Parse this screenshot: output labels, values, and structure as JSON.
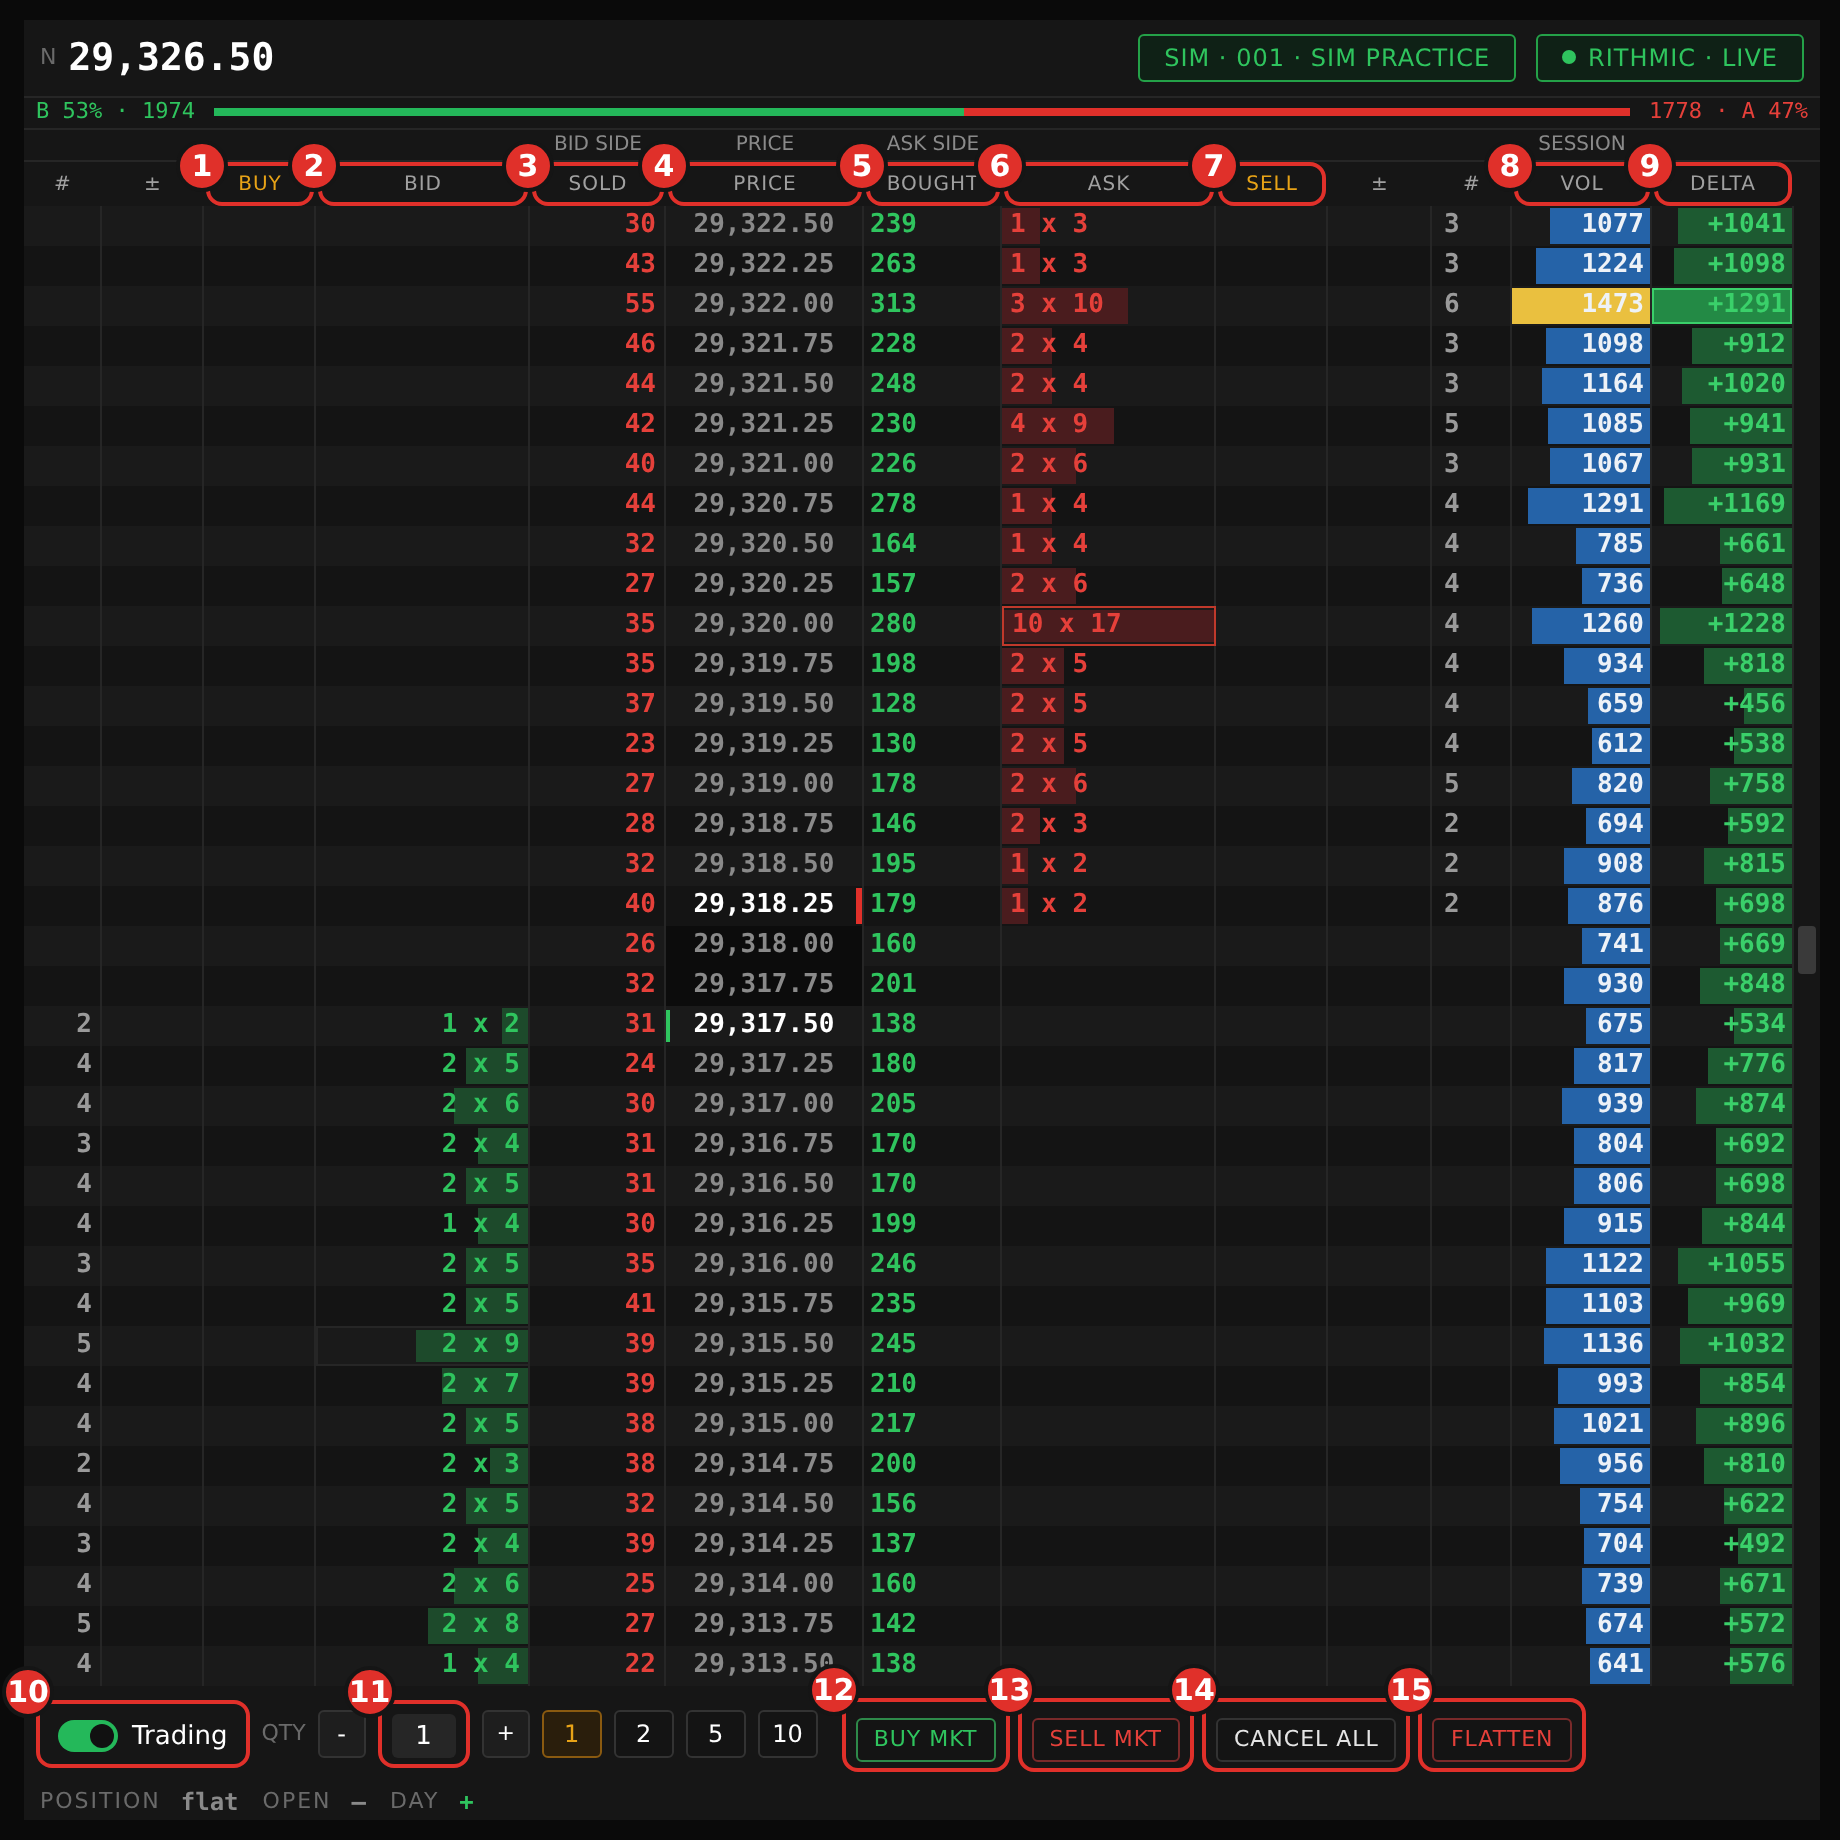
{
  "ticker": {
    "label": "N",
    "price": "29,326.50"
  },
  "accounts": [
    {
      "text": "SIM · 001 · SIM PRACTICE",
      "dot": false
    },
    {
      "text": "RITHMIC · LIVE",
      "dot": true
    }
  ],
  "balance": {
    "bid_text": "B 53% · 1974",
    "ask_text": "1778 · A 47%",
    "level": 0.53
  },
  "columns": [
    {
      "label": "#",
      "highlighted": false
    },
    {
      "label": "±",
      "highlighted": false
    },
    {
      "label": "BUY",
      "highlighted": true,
      "callout": "1"
    },
    {
      "label": "BID",
      "highlighted": false,
      "callout": "2"
    },
    {
      "label": "SOLD",
      "highlighted": false,
      "callout": "3",
      "group": "BID SIDE"
    },
    {
      "label": "PRICE",
      "highlighted": false,
      "callout": "4",
      "group": "PRICE"
    },
    {
      "label": "BOUGHT",
      "highlighted": false,
      "callout": "5",
      "group": "ASK SIDE"
    },
    {
      "label": "ASK",
      "highlighted": false,
      "callout": "6"
    },
    {
      "label": "SELL",
      "highlighted": true,
      "callout": "7"
    },
    {
      "label": "±",
      "highlighted": false
    },
    {
      "label": "#",
      "highlighted": false
    },
    {
      "label": "VOL",
      "highlighted": false,
      "callout": "8",
      "group": "SESSION"
    },
    {
      "label": "DELTA",
      "highlighted": false,
      "callout": "9"
    }
  ],
  "rows": [
    {
      "sold": "30",
      "price": "29,322.50",
      "kind": "normal",
      "bought": "239",
      "ask": {
        "text": "1 x 3",
        "level": 0.18,
        "outlined": false
      },
      "ask_orders": "3",
      "vol": {
        "text": "1077",
        "level": 0.73,
        "highlighted": false
      },
      "delta": {
        "text": "+1041",
        "level": 0.81,
        "highlighted": false
      }
    },
    {
      "sold": "43",
      "price": "29,322.25",
      "kind": "normal",
      "bought": "263",
      "ask": {
        "text": "1 x 3",
        "level": 0.18,
        "outlined": false
      },
      "ask_orders": "3",
      "vol": {
        "text": "1224",
        "level": 0.83,
        "highlighted": false
      },
      "delta": {
        "text": "+1098",
        "level": 0.85,
        "highlighted": false
      }
    },
    {
      "sold": "55",
      "price": "29,322.00",
      "kind": "normal",
      "bought": "313",
      "ask": {
        "text": "3 x 10",
        "level": 0.59,
        "outlined": false
      },
      "ask_orders": "6",
      "vol": {
        "text": "1473",
        "level": 1,
        "highlighted": true
      },
      "delta": {
        "text": "+1291",
        "level": 1,
        "highlighted": true
      }
    },
    {
      "sold": "46",
      "price": "29,321.75",
      "kind": "normal",
      "bought": "228",
      "ask": {
        "text": "2 x 4",
        "level": 0.24,
        "outlined": false
      },
      "ask_orders": "3",
      "vol": {
        "text": "1098",
        "level": 0.75,
        "highlighted": false
      },
      "delta": {
        "text": "+912",
        "level": 0.71,
        "highlighted": false
      }
    },
    {
      "sold": "44",
      "price": "29,321.50",
      "kind": "normal",
      "bought": "248",
      "ask": {
        "text": "2 x 4",
        "level": 0.24,
        "outlined": false
      },
      "ask_orders": "3",
      "vol": {
        "text": "1164",
        "level": 0.79,
        "highlighted": false
      },
      "delta": {
        "text": "+1020",
        "level": 0.79,
        "highlighted": false
      }
    },
    {
      "sold": "42",
      "price": "29,321.25",
      "kind": "normal",
      "bought": "230",
      "ask": {
        "text": "4 x 9",
        "level": 0.53,
        "outlined": false
      },
      "ask_orders": "5",
      "vol": {
        "text": "1085",
        "level": 0.74,
        "highlighted": false
      },
      "delta": {
        "text": "+941",
        "level": 0.73,
        "highlighted": false
      }
    },
    {
      "sold": "40",
      "price": "29,321.00",
      "kind": "normal",
      "bought": "226",
      "ask": {
        "text": "2 x 6",
        "level": 0.35,
        "outlined": false
      },
      "ask_orders": "3",
      "vol": {
        "text": "1067",
        "level": 0.72,
        "highlighted": false
      },
      "delta": {
        "text": "+931",
        "level": 0.72,
        "highlighted": false
      }
    },
    {
      "sold": "44",
      "price": "29,320.75",
      "kind": "normal",
      "bought": "278",
      "ask": {
        "text": "1 x 4",
        "level": 0.24,
        "outlined": false
      },
      "ask_orders": "4",
      "vol": {
        "text": "1291",
        "level": 0.88,
        "highlighted": false
      },
      "delta": {
        "text": "+1169",
        "level": 0.91,
        "highlighted": false
      }
    },
    {
      "sold": "32",
      "price": "29,320.50",
      "kind": "normal",
      "bought": "164",
      "ask": {
        "text": "1 x 4",
        "level": 0.24,
        "outlined": false
      },
      "ask_orders": "4",
      "vol": {
        "text": "785",
        "level": 0.53,
        "highlighted": false
      },
      "delta": {
        "text": "+661",
        "level": 0.51,
        "highlighted": false
      }
    },
    {
      "sold": "27",
      "price": "29,320.25",
      "kind": "normal",
      "bought": "157",
      "ask": {
        "text": "2 x 6",
        "level": 0.35,
        "outlined": false
      },
      "ask_orders": "4",
      "vol": {
        "text": "736",
        "level": 0.5,
        "highlighted": false
      },
      "delta": {
        "text": "+648",
        "level": 0.5,
        "highlighted": false
      }
    },
    {
      "sold": "35",
      "price": "29,320.00",
      "kind": "normal",
      "bought": "280",
      "ask": {
        "text": "10 x 17",
        "level": 1,
        "outlined": true
      },
      "ask_orders": "4",
      "vol": {
        "text": "1260",
        "level": 0.86,
        "highlighted": false
      },
      "delta": {
        "text": "+1228",
        "level": 0.95,
        "highlighted": false
      }
    },
    {
      "sold": "35",
      "price": "29,319.75",
      "kind": "normal",
      "bought": "198",
      "ask": {
        "text": "2 x 5",
        "level": 0.29,
        "outlined": false
      },
      "ask_orders": "4",
      "vol": {
        "text": "934",
        "level": 0.63,
        "highlighted": false
      },
      "delta": {
        "text": "+818",
        "level": 0.63,
        "highlighted": false
      }
    },
    {
      "sold": "37",
      "price": "29,319.50",
      "kind": "normal",
      "bought": "128",
      "ask": {
        "text": "2 x 5",
        "level": 0.29,
        "outlined": false
      },
      "ask_orders": "4",
      "vol": {
        "text": "659",
        "level": 0.45,
        "highlighted": false
      },
      "delta": {
        "text": "+456",
        "level": 0.35,
        "highlighted": false
      }
    },
    {
      "sold": "23",
      "price": "29,319.25",
      "kind": "normal",
      "bought": "130",
      "ask": {
        "text": "2 x 5",
        "level": 0.29,
        "outlined": false
      },
      "ask_orders": "4",
      "vol": {
        "text": "612",
        "level": 0.42,
        "highlighted": false
      },
      "delta": {
        "text": "+538",
        "level": 0.42,
        "highlighted": false
      }
    },
    {
      "sold": "27",
      "price": "29,319.00",
      "kind": "normal",
      "bought": "178",
      "ask": {
        "text": "2 x 6",
        "level": 0.35,
        "outlined": false
      },
      "ask_orders": "5",
      "vol": {
        "text": "820",
        "level": 0.56,
        "highlighted": false
      },
      "delta": {
        "text": "+758",
        "level": 0.59,
        "highlighted": false
      }
    },
    {
      "sold": "28",
      "price": "29,318.75",
      "kind": "normal",
      "bought": "146",
      "ask": {
        "text": "2 x 3",
        "level": 0.18,
        "outlined": false
      },
      "ask_orders": "2",
      "vol": {
        "text": "694",
        "level": 0.47,
        "highlighted": false
      },
      "delta": {
        "text": "+592",
        "level": 0.46,
        "highlighted": false
      }
    },
    {
      "sold": "32",
      "price": "29,318.50",
      "kind": "normal",
      "bought": "195",
      "ask": {
        "text": "1 x 2",
        "level": 0.12,
        "outlined": false
      },
      "ask_orders": "2",
      "vol": {
        "text": "908",
        "level": 0.62,
        "highlighted": false
      },
      "delta": {
        "text": "+815",
        "level": 0.63,
        "highlighted": false
      }
    },
    {
      "sold": "40",
      "price": "29,318.25",
      "kind": "best_ask",
      "bought": "179",
      "ask": {
        "text": "1 x 2",
        "level": 0.12,
        "outlined": false
      },
      "ask_orders": "2",
      "vol": {
        "text": "876",
        "level": 0.59,
        "highlighted": false
      },
      "delta": {
        "text": "+698",
        "level": 0.54,
        "highlighted": false
      }
    },
    {
      "sold": "26",
      "price": "29,318.00",
      "kind": "spread",
      "bought": "160",
      "vol": {
        "text": "741",
        "level": 0.5,
        "highlighted": false
      },
      "delta": {
        "text": "+669",
        "level": 0.52,
        "highlighted": false
      }
    },
    {
      "sold": "32",
      "price": "29,317.75",
      "kind": "spread",
      "bought": "201",
      "vol": {
        "text": "930",
        "level": 0.63,
        "highlighted": false
      },
      "delta": {
        "text": "+848",
        "level": 0.66,
        "highlighted": false
      }
    },
    {
      "bid_orders": "2",
      "bid": {
        "text": "1 x 2",
        "level": 0.12,
        "outlined": false
      },
      "sold": "31",
      "price": "29,317.50",
      "kind": "best_bid",
      "bought": "138",
      "vol": {
        "text": "675",
        "level": 0.46,
        "highlighted": false
      },
      "delta": {
        "text": "+534",
        "level": 0.41,
        "highlighted": false
      }
    },
    {
      "bid_orders": "4",
      "bid": {
        "text": "2 x 5",
        "level": 0.29,
        "outlined": false
      },
      "sold": "24",
      "price": "29,317.25",
      "kind": "normal",
      "bought": "180",
      "vol": {
        "text": "817",
        "level": 0.55,
        "highlighted": false
      },
      "delta": {
        "text": "+776",
        "level": 0.6,
        "highlighted": false
      }
    },
    {
      "bid_orders": "4",
      "bid": {
        "text": "2 x 6",
        "level": 0.35,
        "outlined": false
      },
      "sold": "30",
      "price": "29,317.00",
      "kind": "normal",
      "bought": "205",
      "vol": {
        "text": "939",
        "level": 0.64,
        "highlighted": false
      },
      "delta": {
        "text": "+874",
        "level": 0.68,
        "highlighted": false
      }
    },
    {
      "bid_orders": "3",
      "bid": {
        "text": "2 x 4",
        "level": 0.24,
        "outlined": false
      },
      "sold": "31",
      "price": "29,316.75",
      "kind": "normal",
      "bought": "170",
      "vol": {
        "text": "804",
        "level": 0.55,
        "highlighted": false
      },
      "delta": {
        "text": "+692",
        "level": 0.54,
        "highlighted": false
      }
    },
    {
      "bid_orders": "4",
      "bid": {
        "text": "2 x 5",
        "level": 0.29,
        "outlined": false
      },
      "sold": "31",
      "price": "29,316.50",
      "kind": "normal",
      "bought": "170",
      "vol": {
        "text": "806",
        "level": 0.55,
        "highlighted": false
      },
      "delta": {
        "text": "+698",
        "level": 0.54,
        "highlighted": false
      }
    },
    {
      "bid_orders": "4",
      "bid": {
        "text": "1 x 4",
        "level": 0.24,
        "outlined": false
      },
      "sold": "30",
      "price": "29,316.25",
      "kind": "normal",
      "bought": "199",
      "vol": {
        "text": "915",
        "level": 0.62,
        "highlighted": false
      },
      "delta": {
        "text": "+844",
        "level": 0.65,
        "highlighted": false
      }
    },
    {
      "bid_orders": "3",
      "bid": {
        "text": "2 x 5",
        "level": 0.29,
        "outlined": false
      },
      "sold": "35",
      "price": "29,316.00",
      "kind": "normal",
      "bought": "246",
      "vol": {
        "text": "1122",
        "level": 0.76,
        "highlighted": false
      },
      "delta": {
        "text": "+1055",
        "level": 0.82,
        "highlighted": false
      }
    },
    {
      "bid_orders": "4",
      "bid": {
        "text": "2 x 5",
        "level": 0.29,
        "outlined": false
      },
      "sold": "41",
      "price": "29,315.75",
      "kind": "normal",
      "bought": "235",
      "vol": {
        "text": "1103",
        "level": 0.75,
        "highlighted": false
      },
      "delta": {
        "text": "+969",
        "level": 0.75,
        "highlighted": false
      }
    },
    {
      "bid_orders": "5",
      "bid": {
        "text": "2 x 9",
        "level": 0.53,
        "outlined": true
      },
      "sold": "39",
      "price": "29,315.50",
      "kind": "normal",
      "bought": "245",
      "vol": {
        "text": "1136",
        "level": 0.77,
        "highlighted": false
      },
      "delta": {
        "text": "+1032",
        "level": 0.8,
        "highlighted": false
      }
    },
    {
      "bid_orders": "4",
      "bid": {
        "text": "2 x 7",
        "level": 0.41,
        "outlined": false
      },
      "sold": "39",
      "price": "29,315.25",
      "kind": "normal",
      "bought": "210",
      "vol": {
        "text": "993",
        "level": 0.67,
        "highlighted": false
      },
      "delta": {
        "text": "+854",
        "level": 0.66,
        "highlighted": false
      }
    },
    {
      "bid_orders": "4",
      "bid": {
        "text": "2 x 5",
        "level": 0.29,
        "outlined": false
      },
      "sold": "38",
      "price": "29,315.00",
      "kind": "normal",
      "bought": "217",
      "vol": {
        "text": "1021",
        "level": 0.69,
        "highlighted": false
      },
      "delta": {
        "text": "+896",
        "level": 0.69,
        "highlighted": false
      }
    },
    {
      "bid_orders": "2",
      "bid": {
        "text": "2 x 3",
        "level": 0.18,
        "outlined": false
      },
      "sold": "38",
      "price": "29,314.75",
      "kind": "normal",
      "bought": "200",
      "vol": {
        "text": "956",
        "level": 0.65,
        "highlighted": false
      },
      "delta": {
        "text": "+810",
        "level": 0.63,
        "highlighted": false
      }
    },
    {
      "bid_orders": "4",
      "bid": {
        "text": "2 x 5",
        "level": 0.29,
        "outlined": false
      },
      "sold": "32",
      "price": "29,314.50",
      "kind": "normal",
      "bought": "156",
      "vol": {
        "text": "754",
        "level": 0.51,
        "highlighted": false
      },
      "delta": {
        "text": "+622",
        "level": 0.48,
        "highlighted": false
      }
    },
    {
      "bid_orders": "3",
      "bid": {
        "text": "2 x 4",
        "level": 0.24,
        "outlined": false
      },
      "sold": "39",
      "price": "29,314.25",
      "kind": "normal",
      "bought": "137",
      "vol": {
        "text": "704",
        "level": 0.48,
        "highlighted": false
      },
      "delta": {
        "text": "+492",
        "level": 0.38,
        "highlighted": false
      }
    },
    {
      "bid_orders": "4",
      "bid": {
        "text": "2 x 6",
        "level": 0.35,
        "outlined": false
      },
      "sold": "25",
      "price": "29,314.00",
      "kind": "normal",
      "bought": "160",
      "vol": {
        "text": "739",
        "level": 0.5,
        "highlighted": false
      },
      "delta": {
        "text": "+671",
        "level": 0.52,
        "highlighted": false
      }
    },
    {
      "bid_orders": "5",
      "bid": {
        "text": "2 x 8",
        "level": 0.47,
        "outlined": false
      },
      "sold": "27",
      "price": "29,313.75",
      "kind": "normal",
      "bought": "142",
      "vol": {
        "text": "674",
        "level": 0.46,
        "highlighted": false
      },
      "delta": {
        "text": "+572",
        "level": 0.44,
        "highlighted": false
      }
    },
    {
      "bid_orders": "4",
      "bid": {
        "text": "1 x 4",
        "level": 0.24,
        "outlined": false
      },
      "sold": "22",
      "price": "29,313.50",
      "kind": "normal",
      "bought": "138",
      "vol": {
        "text": "641",
        "level": 0.44,
        "highlighted": false
      },
      "delta": {
        "text": "+576",
        "level": 0.45,
        "highlighted": false
      }
    }
  ],
  "controls": {
    "trading": {
      "label": "Trading",
      "on": true,
      "callout": "10"
    },
    "qty": {
      "label": "QTY",
      "minus": "-",
      "value": "1",
      "plus": "+",
      "callout": "11"
    },
    "presets": [
      {
        "label": "1",
        "selected": true
      },
      {
        "label": "2",
        "selected": false
      },
      {
        "label": "5",
        "selected": false
      },
      {
        "label": "10",
        "selected": false
      }
    ],
    "actions": [
      {
        "label": "BUY MKT",
        "kind": "buy",
        "callout": "12"
      },
      {
        "label": "SELL MKT",
        "kind": "sell",
        "callout": "13"
      },
      {
        "label": "CANCEL ALL",
        "kind": "neutral",
        "callout": "14"
      },
      {
        "label": "FLATTEN",
        "kind": "flatten",
        "callout": "15"
      }
    ]
  },
  "status": [
    {
      "label": "POSITION",
      "value": "flat",
      "kind": "neutral"
    },
    {
      "label": "OPEN",
      "value": "—",
      "kind": "neutral"
    },
    {
      "label": "DAY",
      "value": "+",
      "kind": "positive"
    }
  ]
}
